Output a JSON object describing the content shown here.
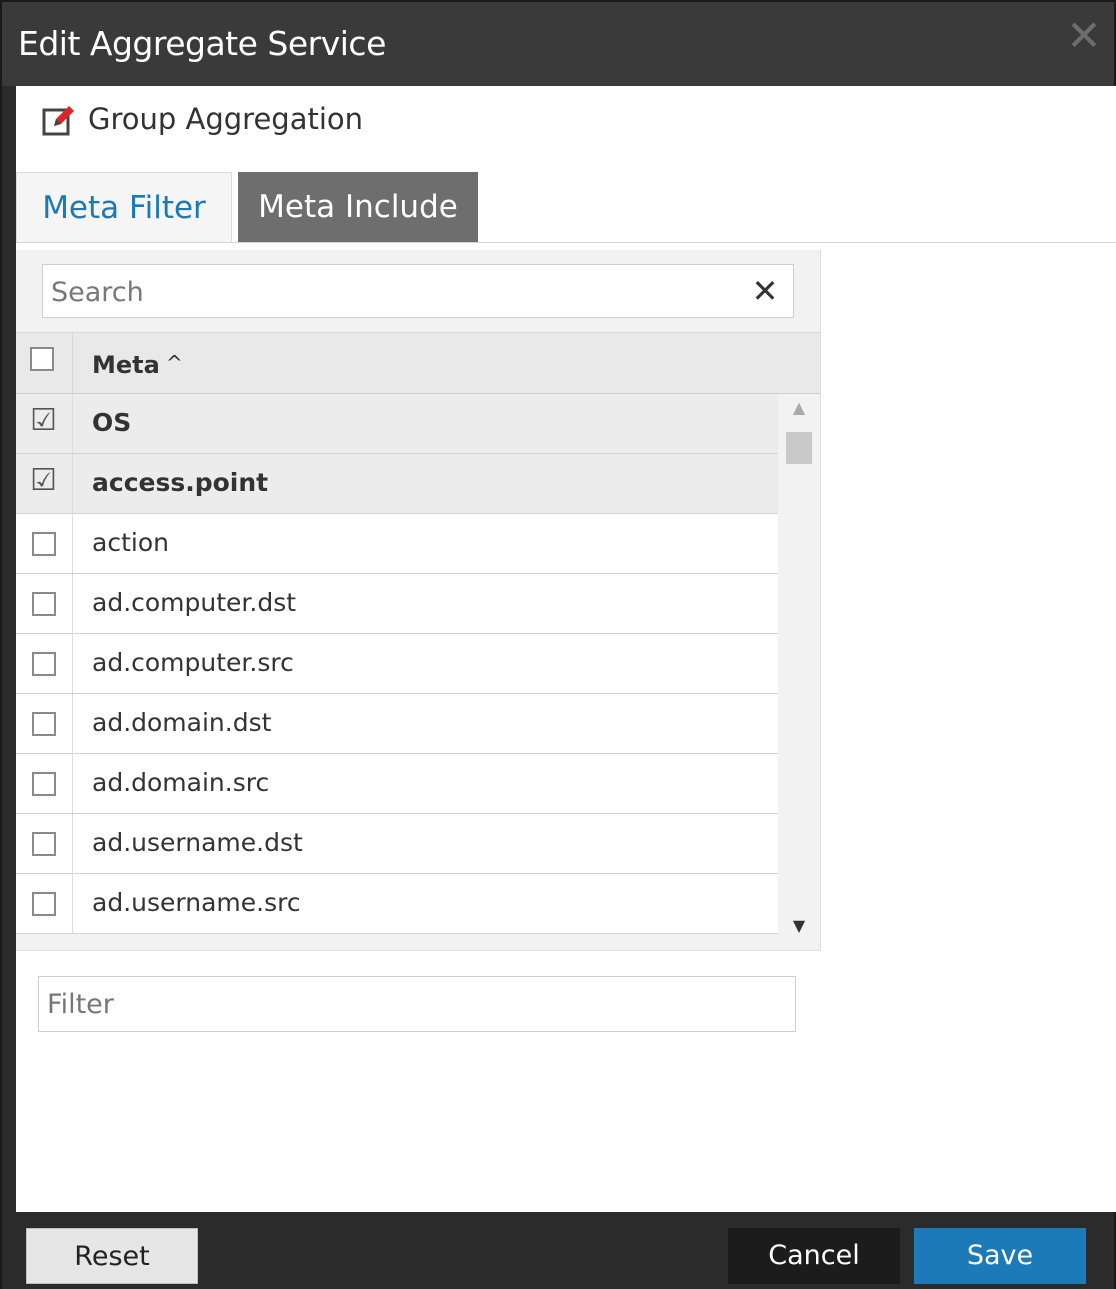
{
  "dialog": {
    "title": "Edit Aggregate Service",
    "close_glyph": "✕"
  },
  "section": {
    "title": "Group Aggregation",
    "icon": "edit-icon"
  },
  "tabs": [
    {
      "label": "Meta Filter",
      "active": true
    },
    {
      "label": "Meta Include",
      "active": false
    }
  ],
  "search": {
    "placeholder": "Search",
    "value": "",
    "clear_glyph": "✕"
  },
  "grid": {
    "header": {
      "label": "Meta",
      "sort": "^"
    },
    "rows": [
      {
        "name": "OS",
        "checked": true
      },
      {
        "name": "access.point",
        "checked": true
      },
      {
        "name": "action",
        "checked": false
      },
      {
        "name": "ad.computer.dst",
        "checked": false
      },
      {
        "name": "ad.computer.src",
        "checked": false
      },
      {
        "name": "ad.domain.dst",
        "checked": false
      },
      {
        "name": "ad.domain.src",
        "checked": false
      },
      {
        "name": "ad.username.dst",
        "checked": false
      },
      {
        "name": "ad.username.src",
        "checked": false
      }
    ]
  },
  "filter": {
    "placeholder": "Filter",
    "value": ""
  },
  "footer": {
    "reset_label": "Reset",
    "cancel_label": "Cancel",
    "save_label": "Save"
  },
  "colors": {
    "accent": "#1d7ab8",
    "icon_red": "#d9262c",
    "titlebar": "#3a3a3a"
  }
}
